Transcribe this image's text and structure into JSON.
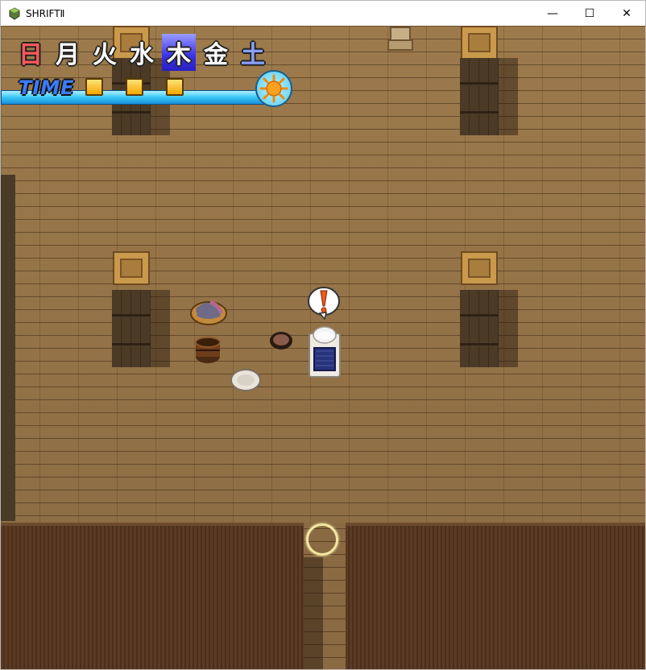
{
  "window": {
    "title": "SHRIFTⅡ"
  },
  "controls": {
    "minimize": "—",
    "maximize": "☐",
    "close": "✕"
  },
  "hud": {
    "days": [
      "日",
      "月",
      "火",
      "水",
      "木",
      "金",
      "土"
    ],
    "active_day": "木",
    "time_label": "TIME",
    "time_slots_filled": 3,
    "time_of_day_icon": "sun-icon"
  },
  "colors": {
    "active_day_bg": "#3a30e8",
    "sunday": "#ff5a5a",
    "saturday": "#8aa0ff",
    "time_bar": "#38c6f5",
    "time_slot": "#f2a800",
    "exit_ring": "#f3e6a0"
  },
  "scene": {
    "alert_icon": "exclamation-balloon-icon"
  }
}
